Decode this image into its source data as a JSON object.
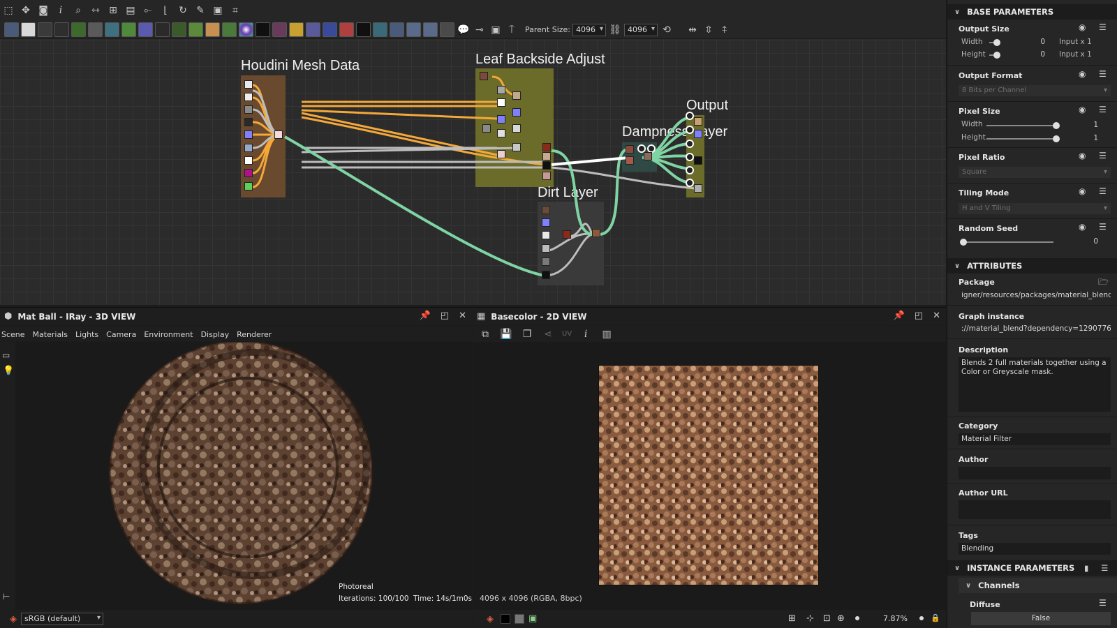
{
  "toolbar": {
    "parent_size_label": "Parent Size:",
    "parent_size_w": "4096",
    "parent_size_h": "4096"
  },
  "graph": {
    "frames": {
      "houdini": "Houdini Mesh Data",
      "leaf": "Leaf Backside Adjust",
      "dampness": "Dampness Layer",
      "dirt": "Dirt Layer",
      "output": "Output"
    }
  },
  "view3d": {
    "title": "Mat Ball - IRay - 3D VIEW",
    "menu": [
      "Scene",
      "Materials",
      "Lights",
      "Camera",
      "Environment",
      "Display",
      "Renderer"
    ],
    "render_mode": "Photoreal",
    "iterations": "Iterations: 100/100",
    "time": "Time: 14s/1m0s",
    "colorspace": "sRGB (default)"
  },
  "view2d": {
    "title": "Basecolor - 2D VIEW",
    "uv_label": "UV",
    "info": "4096 x 4096 (RGBA, 8bpc)",
    "zoom": "7.87%"
  },
  "params": {
    "base_header": "BASE PARAMETERS",
    "output_size": {
      "label": "Output Size",
      "width_label": "Width",
      "height_label": "Height",
      "width_value": "0",
      "height_value": "0",
      "width_mode": "Input x 1",
      "height_mode": "Input x 1"
    },
    "output_format": {
      "label": "Output Format",
      "value": "8 Bits per Channel"
    },
    "pixel_size": {
      "label": "Pixel Size",
      "width_label": "Width",
      "height_label": "Height",
      "width_value": "1",
      "height_value": "1"
    },
    "pixel_ratio": {
      "label": "Pixel Ratio",
      "value": "Square"
    },
    "tiling_mode": {
      "label": "Tiling Mode",
      "value": "H and V Tiling"
    },
    "random_seed": {
      "label": "Random Seed",
      "value": "0"
    },
    "attributes_header": "ATTRIBUTES",
    "package": {
      "label": "Package",
      "value": "igner/resources/packages/material_blend.sbs"
    },
    "graph_instance": {
      "label": "Graph instance",
      "value": "://material_blend?dependency=1290776917"
    },
    "description": {
      "label": "Description",
      "value": "Blends 2 full materials together using a Color or Greyscale mask."
    },
    "category": {
      "label": "Category",
      "value": "Material Filter"
    },
    "author": {
      "label": "Author",
      "value": ""
    },
    "author_url": {
      "label": "Author URL",
      "value": ""
    },
    "tags": {
      "label": "Tags",
      "value": "Blending"
    },
    "instance_header": "INSTANCE PARAMETERS",
    "channels_header": "Channels",
    "diffuse": {
      "label": "Diffuse",
      "value": "False"
    }
  },
  "colors": {
    "orange_wire": "#f4a83a",
    "grey_wire": "#bdbdbd",
    "green_wire": "#7fd4a4",
    "frame_brown": "#6a4a2e",
    "frame_olive": "#6b6b2a",
    "frame_dark": "#3a3a3a",
    "frame_teal": "#2f4a45"
  },
  "icons": [
    "select-icon",
    "pan-icon",
    "screenshot-icon",
    "info-icon",
    "zoom-icon",
    "fit-icon",
    "layout-icon",
    "frame-icon",
    "link-icon",
    "align-icon",
    "refresh-icon",
    "tools-icon",
    "snap-icon",
    "crop-icon"
  ]
}
